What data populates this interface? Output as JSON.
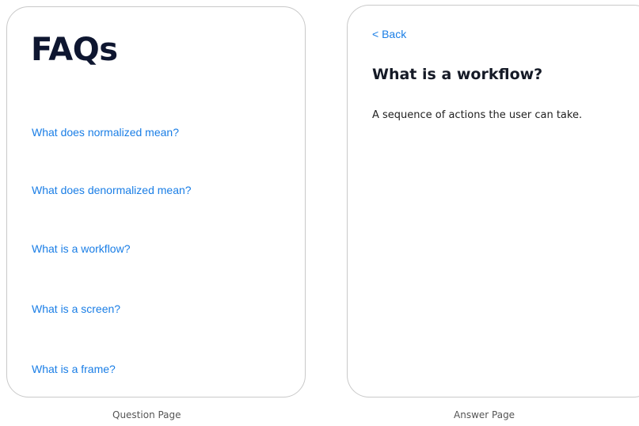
{
  "question_page": {
    "title": "FAQs",
    "questions": [
      "What does normalized mean?",
      "What does denormalized mean?",
      "What is a workflow?",
      "What is a screen?",
      "What is a frame?"
    ],
    "caption": "Question Page"
  },
  "answer_page": {
    "back_label": "< Back",
    "title": "What is a workflow?",
    "body": "A sequence of actions the user can take.",
    "caption": "Answer Page"
  },
  "colors": {
    "link": "#1a7ee6",
    "heading": "#0e1630",
    "border": "#c9c9c9"
  }
}
